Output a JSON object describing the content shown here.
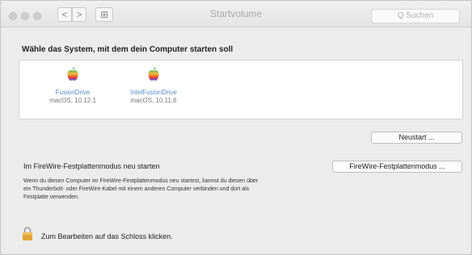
{
  "window": {
    "title": "Startvolume"
  },
  "toolbar": {
    "back_glyph": "<",
    "forward_glyph": ">",
    "grid_glyph": "⊞",
    "search_placeholder": "Q Suchen"
  },
  "startup_disk": {
    "heading": "Wähle das System, mit dem dein Computer starten soll",
    "disks": [
      {
        "name": "FusionDrive",
        "os": "macOS, 10.12.1",
        "icon": "apple-logo-icon"
      },
      {
        "name": "IntelFusionDrive",
        "os": "macOS, 10.11.6",
        "icon": "apple-logo-icon"
      }
    ],
    "restart_label": "Neustart ..."
  },
  "firewire": {
    "title": "Im FireWire-Festplattenmodus neu starten",
    "button_label": "FireWire-Festplattenmodus ...",
    "description": "Wenn du diesen Computer im FireWire-Festplattenmodus neu startest, kannst du diesen über ein Thunderbolt- oder FireWire-Kabel mit einem anderen Computer verbinden und dort als Festplatte verwenden."
  },
  "lock": {
    "text": "Zum Bearbeiten auf das Schloss klicken.",
    "icon": "lock-icon"
  },
  "colors": {
    "accent_link": "#5c8ccc",
    "lock_gold": "#e0a33a"
  }
}
